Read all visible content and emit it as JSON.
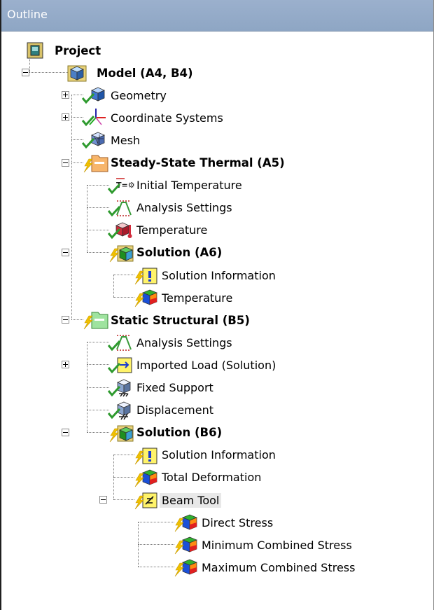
{
  "panel": {
    "title": "Outline"
  },
  "tree": [
    {
      "id": "project",
      "label": "Project",
      "bold": true,
      "icon": "project-icon",
      "depth": 0,
      "expander": "none"
    },
    {
      "id": "model",
      "label": "Model (A4, B4)",
      "bold": true,
      "icon": "model-cube-icon",
      "depth": 1,
      "expander": "minus"
    },
    {
      "id": "geometry",
      "label": "Geometry",
      "icon": "geometry-icon",
      "depth": 2,
      "expander": "plus",
      "status": "check"
    },
    {
      "id": "coordsys",
      "label": "Coordinate Systems",
      "icon": "coordinate-axes-icon",
      "depth": 2,
      "expander": "plus",
      "status": "check"
    },
    {
      "id": "mesh",
      "label": "Mesh",
      "icon": "mesh-icon",
      "depth": 2,
      "expander": "none",
      "status": "check"
    },
    {
      "id": "thermal",
      "label": "Steady-State Thermal (A5)",
      "bold": true,
      "icon": "thermal-analysis-icon",
      "depth": 2,
      "expander": "minus",
      "status": "lightning"
    },
    {
      "id": "init-temp",
      "label": "Initial Temperature",
      "icon": "initial-temperature-icon",
      "depth": 3,
      "expander": "none",
      "status": "check"
    },
    {
      "id": "analysis-thermal",
      "label": "Analysis Settings",
      "icon": "analysis-settings-icon",
      "depth": 3,
      "expander": "none",
      "status": "check"
    },
    {
      "id": "temp-load",
      "label": "Temperature",
      "icon": "temperature-load-icon",
      "depth": 3,
      "expander": "none",
      "status": "check"
    },
    {
      "id": "solution-a6",
      "label": "Solution (A6)",
      "bold": true,
      "icon": "solution-icon",
      "depth": 3,
      "expander": "minus",
      "status": "lightning"
    },
    {
      "id": "solinfo-a6",
      "label": "Solution Information",
      "icon": "solution-information-icon",
      "depth": 4,
      "expander": "none",
      "status": "lightning"
    },
    {
      "id": "temp-result",
      "label": "Temperature",
      "icon": "result-contour-icon",
      "depth": 4,
      "expander": "none",
      "status": "lightning"
    },
    {
      "id": "structural",
      "label": "Static Structural (B5)",
      "bold": true,
      "icon": "structural-analysis-icon",
      "depth": 2,
      "expander": "minus",
      "status": "lightning"
    },
    {
      "id": "analysis-struct",
      "label": "Analysis Settings",
      "icon": "analysis-settings-icon",
      "depth": 3,
      "expander": "none",
      "status": "check"
    },
    {
      "id": "imported-load",
      "label": "Imported Load (Solution)",
      "icon": "imported-load-icon",
      "depth": 3,
      "expander": "plus",
      "status": "check"
    },
    {
      "id": "fixed-support",
      "label": "Fixed Support",
      "icon": "fixed-support-icon",
      "depth": 3,
      "expander": "none",
      "status": "check"
    },
    {
      "id": "displacement",
      "label": "Displacement",
      "icon": "displacement-icon",
      "depth": 3,
      "expander": "none",
      "status": "check"
    },
    {
      "id": "solution-b6",
      "label": "Solution (B6)",
      "bold": true,
      "icon": "solution-icon",
      "depth": 3,
      "expander": "minus",
      "status": "lightning"
    },
    {
      "id": "solinfo-b6",
      "label": "Solution Information",
      "icon": "solution-information-icon",
      "depth": 4,
      "expander": "none",
      "status": "lightning"
    },
    {
      "id": "total-def",
      "label": "Total Deformation",
      "icon": "result-contour-icon",
      "depth": 4,
      "expander": "none",
      "status": "lightning"
    },
    {
      "id": "beam-tool",
      "label": "Beam Tool",
      "icon": "beam-tool-icon",
      "depth": 4,
      "expander": "minus",
      "status": "lightning",
      "selected": true
    },
    {
      "id": "direct-stress",
      "label": "Direct Stress",
      "icon": "result-contour-icon",
      "depth": 5,
      "expander": "none",
      "status": "lightning"
    },
    {
      "id": "min-comb",
      "label": "Minimum Combined Stress",
      "icon": "result-contour-icon",
      "depth": 5,
      "expander": "none",
      "status": "lightning"
    },
    {
      "id": "max-comb",
      "label": "Maximum Combined Stress",
      "icon": "result-contour-icon",
      "depth": 5,
      "expander": "none",
      "status": "lightning"
    }
  ],
  "colors": {
    "check": "#2e9a2e",
    "lightning": "#f0c000",
    "titlebar": "#8ea6c4"
  }
}
